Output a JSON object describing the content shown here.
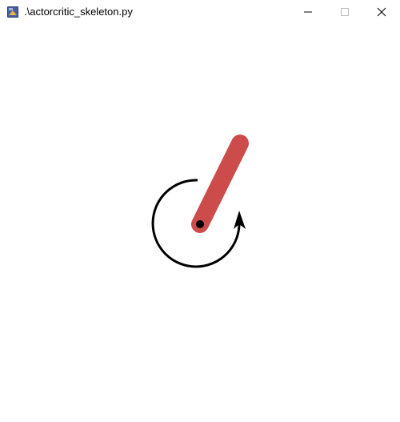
{
  "window": {
    "title": ".\\actorcritic_skeleton.py",
    "app_icon": "python-app-icon",
    "controls": {
      "minimize_icon": "minimize-icon",
      "maximize_icon": "maximize-icon",
      "close_icon": "close-icon"
    }
  },
  "scene": {
    "description_icons": [
      "pendulum-rod",
      "pivot-joint",
      "torque-arrow"
    ],
    "rod_color": "#cc4c4c",
    "pivot_color": "#000000",
    "arrow_color": "#000000",
    "background": "#ffffff"
  }
}
